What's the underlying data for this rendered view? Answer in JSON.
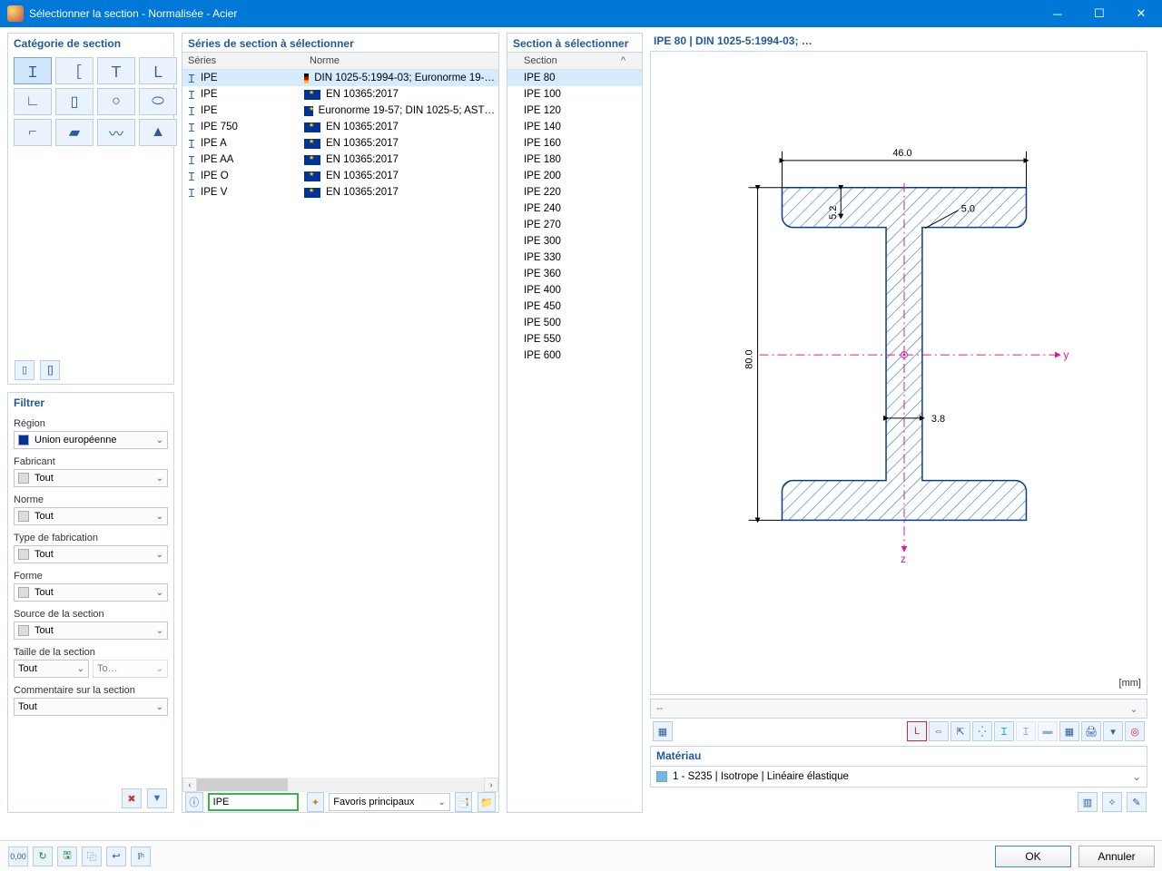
{
  "window_title": "Sélectionner la section - Normalisée - Acier",
  "panels": {
    "category_title": "Catégorie de section",
    "series_title": "Séries de section à sélectionner",
    "section_title": "Section à sélectionner",
    "filter_title": "Filtrer",
    "material_title": "Matériau"
  },
  "category_icons": [
    "Ｉ",
    "［",
    "Ｔ",
    "Ｌ",
    "∟",
    "▯",
    "○",
    "⬭",
    "⌐",
    "▰",
    "〰",
    "▲"
  ],
  "series_header": {
    "c1": "Séries",
    "c2": "Norme"
  },
  "series": [
    {
      "name": "IPE",
      "flag": "de",
      "norm": "DIN 1025-5:1994-03; Euronorme 19-…",
      "selected": true
    },
    {
      "name": "IPE",
      "flag": "eu",
      "norm": "EN 10365:2017"
    },
    {
      "name": "IPE",
      "flag": "eu",
      "norm": "Euronorme 19-57; DIN 1025-5; AST…"
    },
    {
      "name": "IPE 750",
      "flag": "eu",
      "norm": "EN 10365:2017"
    },
    {
      "name": "IPE A",
      "flag": "eu",
      "norm": "EN 10365:2017"
    },
    {
      "name": "IPE AA",
      "flag": "eu",
      "norm": "EN 10365:2017"
    },
    {
      "name": "IPE O",
      "flag": "eu",
      "norm": "EN 10365:2017"
    },
    {
      "name": "IPE V",
      "flag": "eu",
      "norm": "EN 10365:2017"
    }
  ],
  "section_header": "Section",
  "sections": [
    "IPE 80",
    "IPE 100",
    "IPE 120",
    "IPE 140",
    "IPE 160",
    "IPE 180",
    "IPE 200",
    "IPE 220",
    "IPE 240",
    "IPE 270",
    "IPE 300",
    "IPE 330",
    "IPE 360",
    "IPE 400",
    "IPE 450",
    "IPE 500",
    "IPE 550",
    "IPE 600"
  ],
  "selected_section_index": 0,
  "preview_title": "IPE 80 | DIN 1025-5:1994-03; …",
  "dimensions": {
    "width": "46.0",
    "height": "80.0",
    "flange_t": "5.2",
    "web_t": "3.8",
    "radius": "5.0"
  },
  "unit_label": "[mm]",
  "info_bar_text": "--",
  "material_value": "1 - S235 | Isotrope | Linéaire élastique",
  "filters": {
    "region_label": "Région",
    "region_value": "Union européenne",
    "manufacturer_label": "Fabricant",
    "manufacturer_value": "Tout",
    "norm_label": "Norme",
    "norm_value": "Tout",
    "fab_label": "Type de fabrication",
    "fab_value": "Tout",
    "shape_label": "Forme",
    "shape_value": "Tout",
    "source_label": "Source de la section",
    "source_value": "Tout",
    "size_label": "Taille de la section",
    "size_value_a": "Tout",
    "size_value_b": "To…",
    "comment_label": "Commentaire sur la section",
    "comment_value": "Tout"
  },
  "search_value": "IPE",
  "favorites_label": "Favoris principaux",
  "buttons": {
    "ok": "OK",
    "cancel": "Annuler"
  },
  "chart_data": {
    "type": "diagram",
    "description": "Dimensioned drawing of an IPE 80 steel I-beam cross-section",
    "width_mm": 46.0,
    "height_mm": 80.0,
    "flange_thickness_mm": 5.2,
    "web_thickness_mm": 3.8,
    "root_radius_mm": 5.0,
    "y_axis": "right (magenta dashed)",
    "z_axis": "down (magenta dashed)"
  }
}
